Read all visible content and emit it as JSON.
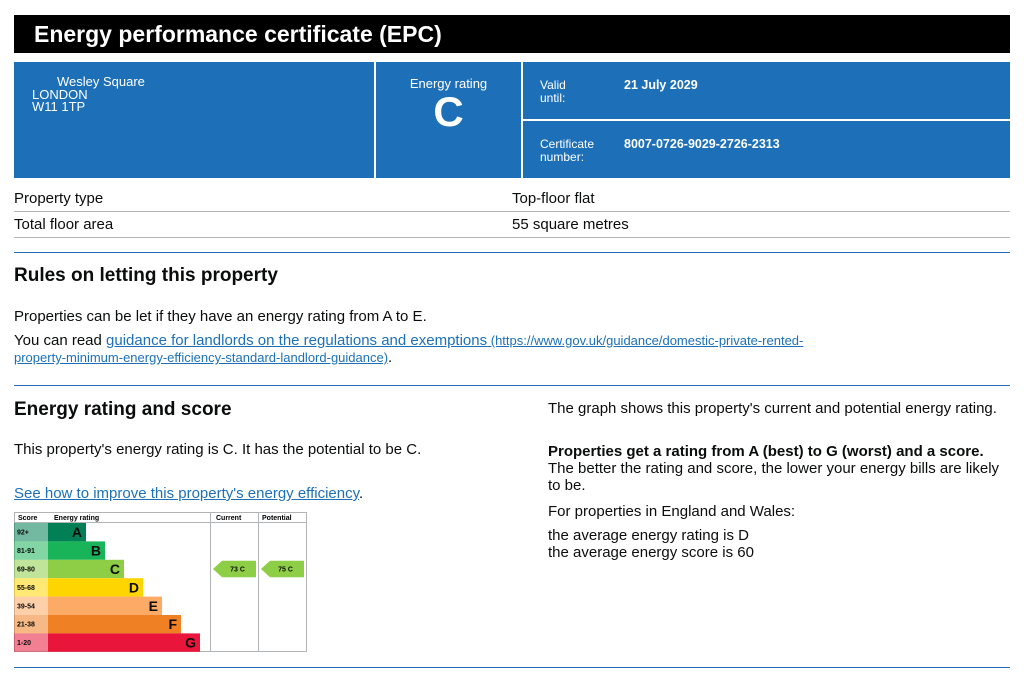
{
  "header": {
    "title": "Energy performance certificate (EPC)"
  },
  "summary": {
    "address_line1": "Wesley Square",
    "address_line2": "LONDON",
    "address_line3": "W11 1TP",
    "energy_rating_label": "Energy rating",
    "energy_rating": "C",
    "valid_until_label_1": "Valid",
    "valid_until_label_2": "until:",
    "valid_until": "21 July 2029",
    "cert_label_1": "Certificate",
    "cert_label_2": "number:",
    "cert_number": "8007-0726-9029-2726-2313"
  },
  "property": {
    "type_label": "Property type",
    "type_value": "Top-floor flat",
    "area_label": "Total floor area",
    "area_value": "55 square metres"
  },
  "letting": {
    "heading": "Rules on letting this property",
    "para1": "Properties can be let if they have an energy rating from A to E.",
    "para2_prefix": "You can read ",
    "para2_link": "guidance for landlords on the regulations and exemptions",
    "para2_url_a": " (https://www.gov.uk/guidance/domestic-private-rented-",
    "para2_url_b": "property-minimum-energy-efficiency-standard-landlord-guidance)",
    "para2_suffix": "."
  },
  "score": {
    "heading": "Energy rating and score",
    "para1": "This property's energy rating is C. It has the potential to be C.",
    "link": "See how to improve this property's energy efficiency",
    "link_suffix": ".",
    "right1": "The graph shows this property's current and potential energy rating.",
    "right2_bold": "Properties get a rating from A (best) to G (worst) and a score.",
    "right2_rest": " The better the rating and score, the lower your energy bills are likely to be.",
    "right3": "For properties in England and Wales:",
    "right4": "the average energy rating is D",
    "right5": "the average energy score is 60"
  },
  "chart_data": {
    "type": "bar",
    "headers": {
      "score": "Score",
      "rating": "Energy rating",
      "current": "Current",
      "potential": "Potential"
    },
    "bands": [
      {
        "range": "92+",
        "letter": "A",
        "color": "#008054"
      },
      {
        "range": "81-91",
        "letter": "B",
        "color": "#19b459"
      },
      {
        "range": "69-80",
        "letter": "C",
        "color": "#8dce46"
      },
      {
        "range": "55-68",
        "letter": "D",
        "color": "#ffd500"
      },
      {
        "range": "39-54",
        "letter": "E",
        "color": "#fcaa65"
      },
      {
        "range": "21-38",
        "letter": "F",
        "color": "#ef8023"
      },
      {
        "range": "1-20",
        "letter": "G",
        "color": "#e9153b"
      }
    ],
    "current": {
      "score": 73,
      "letter": "C",
      "label": "73 C"
    },
    "potential": {
      "score": 75,
      "letter": "C",
      "label": "75 C"
    }
  }
}
